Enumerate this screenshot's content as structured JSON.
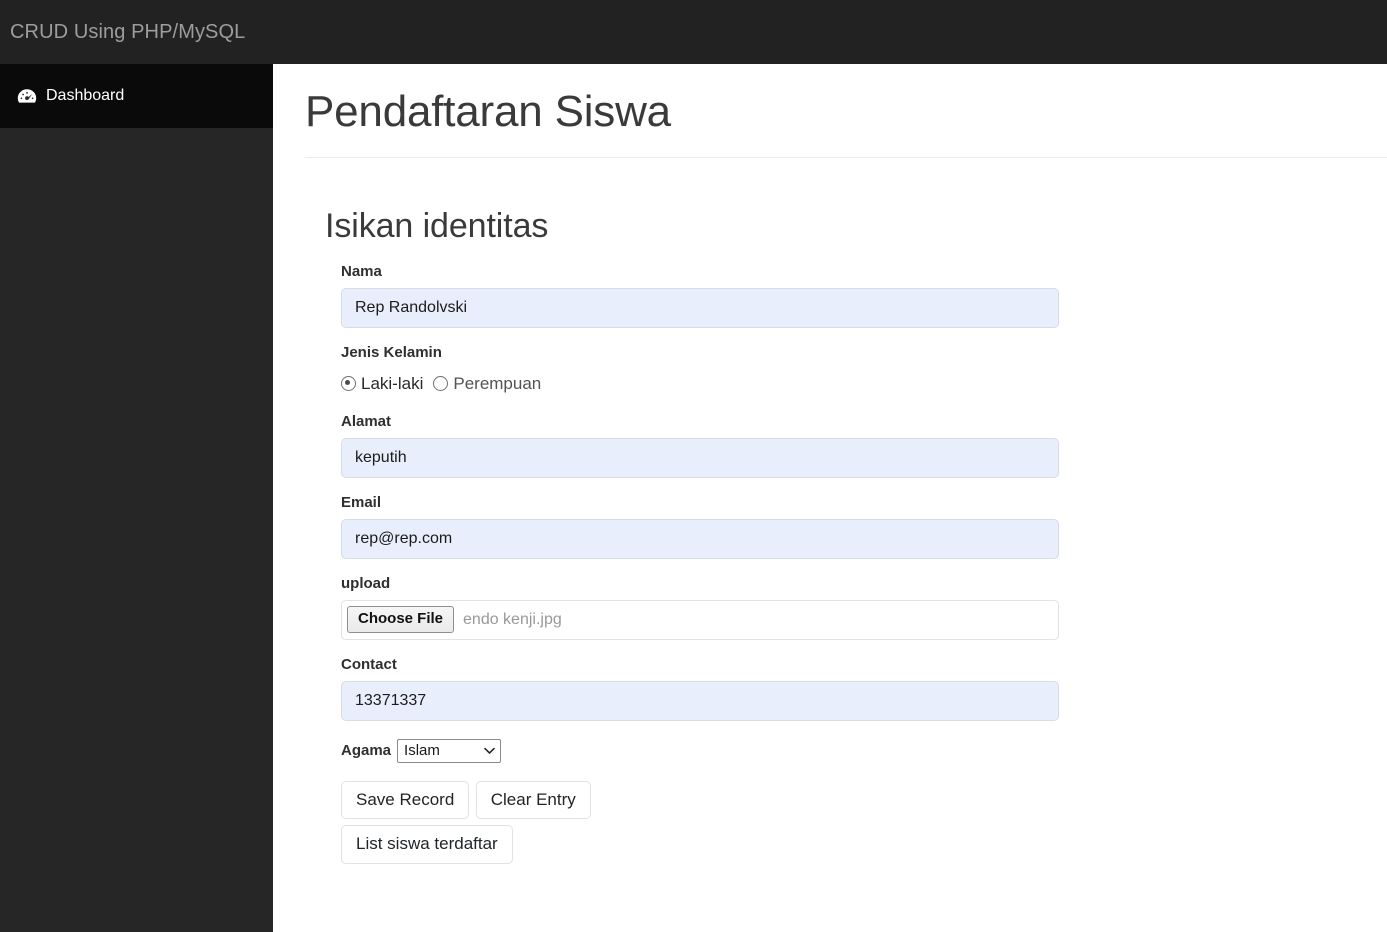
{
  "navbar": {
    "brand": "CRUD Using PHP/MySQL"
  },
  "sidebar": {
    "items": [
      {
        "label": "Dashboard",
        "icon": "tachometer-icon",
        "active": true
      }
    ]
  },
  "main": {
    "page_title": "Pendaftaran Siswa",
    "section_title": "Isikan identitas",
    "fields": {
      "nama": {
        "label": "Nama",
        "value": "Rep Randolvski"
      },
      "jenis_kelamin": {
        "label": "Jenis Kelamin",
        "options": [
          {
            "label": "Laki-laki",
            "checked": true
          },
          {
            "label": "Perempuan",
            "checked": false
          }
        ]
      },
      "alamat": {
        "label": "Alamat",
        "value": "keputih"
      },
      "email": {
        "label": "Email",
        "value": "rep@rep.com"
      },
      "upload": {
        "label": "upload",
        "button_label": "Choose File",
        "file_name": "endo kenji.jpg"
      },
      "contact": {
        "label": "Contact",
        "value": "13371337"
      },
      "agama": {
        "label": "Agama",
        "value": "Islam"
      }
    },
    "buttons": {
      "save": "Save Record",
      "clear": "Clear Entry",
      "list": "List siswa terdaftar"
    }
  },
  "colors": {
    "navbar_bg": "#222222",
    "sidebar_bg": "#262626",
    "sidebar_active_bg": "#0a0a0a",
    "brand_text": "#9d9d9d",
    "autofill_input_bg": "#e8eefb",
    "text": "#212529"
  }
}
